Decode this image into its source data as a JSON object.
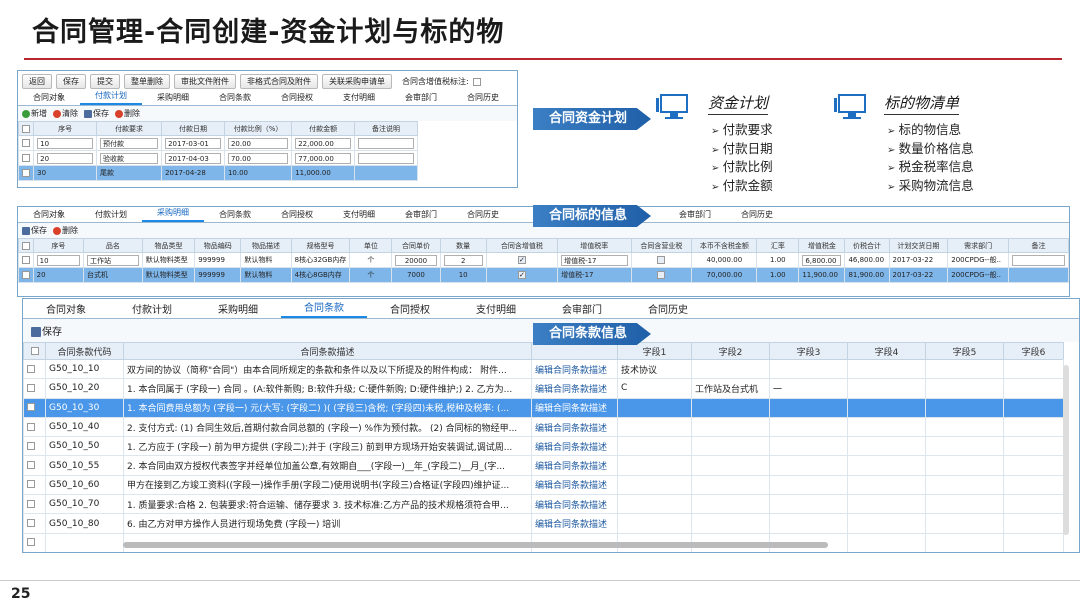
{
  "title": "合同管理-合同创建-资金计划与标的物",
  "page_number": "25",
  "panel1": {
    "toolbar": [
      "返回",
      "保存",
      "提交",
      "整单删除",
      "审批文件附件",
      "非格式合同及附件",
      "关联采购申请单"
    ],
    "tax_label": "合同含增值税标注:",
    "tabs": [
      "合同对象",
      "付款计划",
      "采购明细",
      "合同条款",
      "合同授权",
      "支付明细",
      "会审部门",
      "合同历史"
    ],
    "sub": {
      "add": "新增",
      "clear": "清除",
      "save": "保存",
      "delete": "删除"
    },
    "headers": [
      "序号",
      "付款要求",
      "付款日期",
      "付款比例（%）",
      "付款金额",
      "备注说明"
    ],
    "rows": [
      [
        "10",
        "预付款",
        "2017-03-01",
        "20.00",
        "22,000.00",
        ""
      ],
      [
        "20",
        "验收款",
        "2017-04-03",
        "70.00",
        "77,000.00",
        ""
      ],
      [
        "30",
        "尾款",
        "2017-04-28",
        "10.00",
        "11,000.00",
        ""
      ]
    ]
  },
  "pill1": "合同资金计划",
  "pill2": "合同标的信息",
  "pill3": "合同条款信息",
  "fund": {
    "title": "资金计划",
    "items": [
      "付款要求",
      "付款日期",
      "付款比例",
      "付款金额"
    ]
  },
  "subject": {
    "title": "标的物清单",
    "items": [
      "标的物信息",
      "数量价格信息",
      "税金税率信息",
      "采购物流信息"
    ]
  },
  "panel2": {
    "tabs": [
      "合同对象",
      "付款计划",
      "采购明细",
      "合同条款",
      "合同授权",
      "支付明细",
      "会审部门",
      "合同历史"
    ],
    "tabs_right": [
      "会审部门",
      "合同历史"
    ],
    "sub": {
      "save": "保存",
      "delete": "删除"
    },
    "headers": [
      "序号",
      "品名",
      "物品类型",
      "物品编码",
      "物品描述",
      "规格型号",
      "单位",
      "合同单价",
      "数量",
      "合同含增值税",
      "增值税率",
      "合同含营业税",
      "本币不含税金额",
      "汇率",
      "增值税金",
      "价税合计",
      "计划交货日期",
      "需求部门",
      "备注"
    ],
    "rows": [
      [
        "10",
        "工作站",
        "默认物料类型",
        "999999",
        "默认物料",
        "8核心32GB内存",
        "个",
        "20000",
        "2",
        "",
        "增值税-17",
        "",
        "40,000.00",
        "1.00",
        "6,800.00",
        "46,800.00",
        "2017-03-22",
        "200CPDG--般..",
        ""
      ],
      [
        "20",
        "台式机",
        "默认物料类型",
        "999999",
        "默认物料",
        "4核心8GB内存",
        "个",
        "7000",
        "10",
        "",
        "增值税-17",
        "",
        "70,000.00",
        "1.00",
        "11,900.00",
        "81,900.00",
        "2017-03-22",
        "200CPDG--般..",
        ""
      ]
    ]
  },
  "panel3": {
    "tabs": [
      "合同对象",
      "付款计划",
      "采购明细",
      "合同条款",
      "合同授权",
      "支付明细",
      "会审部门",
      "合同历史"
    ],
    "save": "保存",
    "headers": [
      "合同条款代码",
      "合同条款描述",
      "",
      "字段1",
      "字段2",
      "字段3",
      "字段4",
      "字段5",
      "字段6"
    ],
    "rows": [
      [
        "G50_10_10",
        "双方间的协议（简称\"合同\"）由本合同所规定的条款和条件以及以下所提及的附件构成： 附件...",
        "编辑合同条款描述",
        "技术协议",
        "",
        "",
        "",
        "",
        ""
      ],
      [
        "G50_10_20",
        "1. 本合同属于 (字段一) 合同 。(A:软件新购; B:软件升级; C:硬件新购; D:硬件维护;) 2. 乙方为...",
        "编辑合同条款描述",
        "C",
        "工作站及台式机",
        "一",
        "",
        "",
        ""
      ],
      [
        "G50_10_30",
        "1. 本合同费用总额为 (字段一) 元(大写: (字段二) )( (字段三)含税; (字段四)未税,税种及税率: (...",
        "编辑合同条款描述",
        "",
        "",
        "",
        "",
        "",
        ""
      ],
      [
        "G50_10_40",
        "2. 支付方式: (1) 合同生效后,首期付款合同总额的 (字段一) %作为预付款。 (2) 合同标的物经甲...",
        "编辑合同条款描述",
        "",
        "",
        "",
        "",
        "",
        ""
      ],
      [
        "G50_10_50",
        "1. 乙方应于 (字段一) 前为甲方提供 (字段二);并于 (字段三) 前到甲方现场开始安装调试,调试周...",
        "编辑合同条款描述",
        "",
        "",
        "",
        "",
        "",
        ""
      ],
      [
        "G50_10_55",
        "2. 本合同由双方授权代表签字并经单位加盖公章,有效期自___(字段一)__年_(字段二)__月_(字...",
        "编辑合同条款描述",
        "",
        "",
        "",
        "",
        "",
        ""
      ],
      [
        "G50_10_60",
        "甲方在接到乙方竣工资料((字段一)操作手册(字段二)使用说明书(字段三)合格证(字段四)维护证...",
        "编辑合同条款描述",
        "",
        "",
        "",
        "",
        "",
        ""
      ],
      [
        "G50_10_70",
        "1. 质量要求:合格 2. 包装要求:符合运输、储存要求 3. 技术标准:乙方产品的技术规格须符合甲...",
        "编辑合同条款描述",
        "",
        "",
        "",
        "",
        "",
        ""
      ],
      [
        "G50_10_80",
        "6. 由乙方对甲方操作人员进行现场免费 (字段一) 培训",
        "编辑合同条款描述",
        "",
        "",
        "",
        "",
        "",
        ""
      ]
    ]
  }
}
